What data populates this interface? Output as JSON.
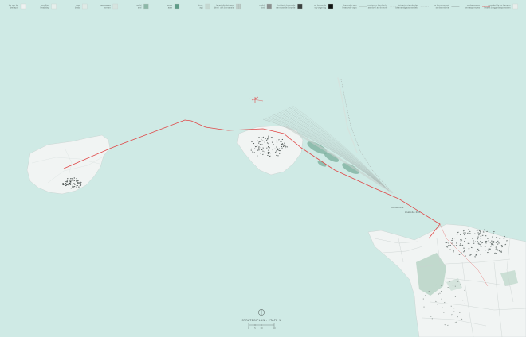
{
  "legend": {
    "items": [
      {
        "label": "be om be\nbel apis",
        "swatch": "#eef2f1",
        "kind": "box"
      },
      {
        "label": "nordlag\nbesbdag",
        "swatch": "#e6efec",
        "kind": "box"
      },
      {
        "label": "dag\nbesb",
        "swatch": "#dfeae6",
        "kind": "box"
      },
      {
        "label": "hemmeles\nnordsn",
        "swatch": "#d6e4df",
        "kind": "box"
      },
      {
        "label": "wald\nsvd",
        "swatch": "#8db8a8",
        "kind": "box"
      },
      {
        "label": "apsis\nawe",
        "swatch": "#5f9c88",
        "kind": "box"
      },
      {
        "label": "dodr\napt",
        "swatch": "#c4d8d1",
        "kind": "box"
      },
      {
        "label": "laceri din bridarp\nbirs i ubt barssosis",
        "swatch": "#bfcfca",
        "kind": "dots"
      },
      {
        "label": "nodd\nsiat",
        "swatch": "#8a8f8e",
        "kind": "box"
      },
      {
        "label": "bridarig bygguds\nsandvande boyrde",
        "swatch": "#3b4240",
        "kind": "box"
      },
      {
        "label": "ny bygguds\nog vegning",
        "swatch": "#101412",
        "kind": "box"
      },
      {
        "label": "bearvde sais\nbeanvstv apis",
        "swatch": "#8b9693",
        "kind": "line"
      },
      {
        "label": "norlag ur tondenlui\nsandvol av dnavdo",
        "swatch": "#b7c1be",
        "kind": "dash"
      },
      {
        "label": "bridarig vianvbrdes\nbeansvdg savnandela",
        "swatch": "#9aa4a1",
        "kind": "dash"
      },
      {
        "label": "sa bonnvonard\nsa danvdaria",
        "swatch": "#6f7977",
        "kind": "line"
      },
      {
        "label": "nodsesvaing\nondaspnnu es",
        "swatch": "#e05a5a",
        "kind": "redline"
      },
      {
        "label": "danske lile ny basann\nbeskit bygguds sponsden",
        "swatch": "#e8eeec",
        "kind": "box"
      }
    ]
  },
  "map": {
    "water_color": "#cfeae5",
    "land_color": "#f1f4f3",
    "green_color": "#b9d3c6",
    "building_color": "#3a4240",
    "route_color": "#e04848",
    "route_label": "Koldsbinde\nLoakobe 200"
  },
  "footer": {
    "title": "STRATEGIPLAN - ETAPE 1",
    "scale_labels": [
      "0",
      "5",
      "10",
      "50"
    ]
  }
}
